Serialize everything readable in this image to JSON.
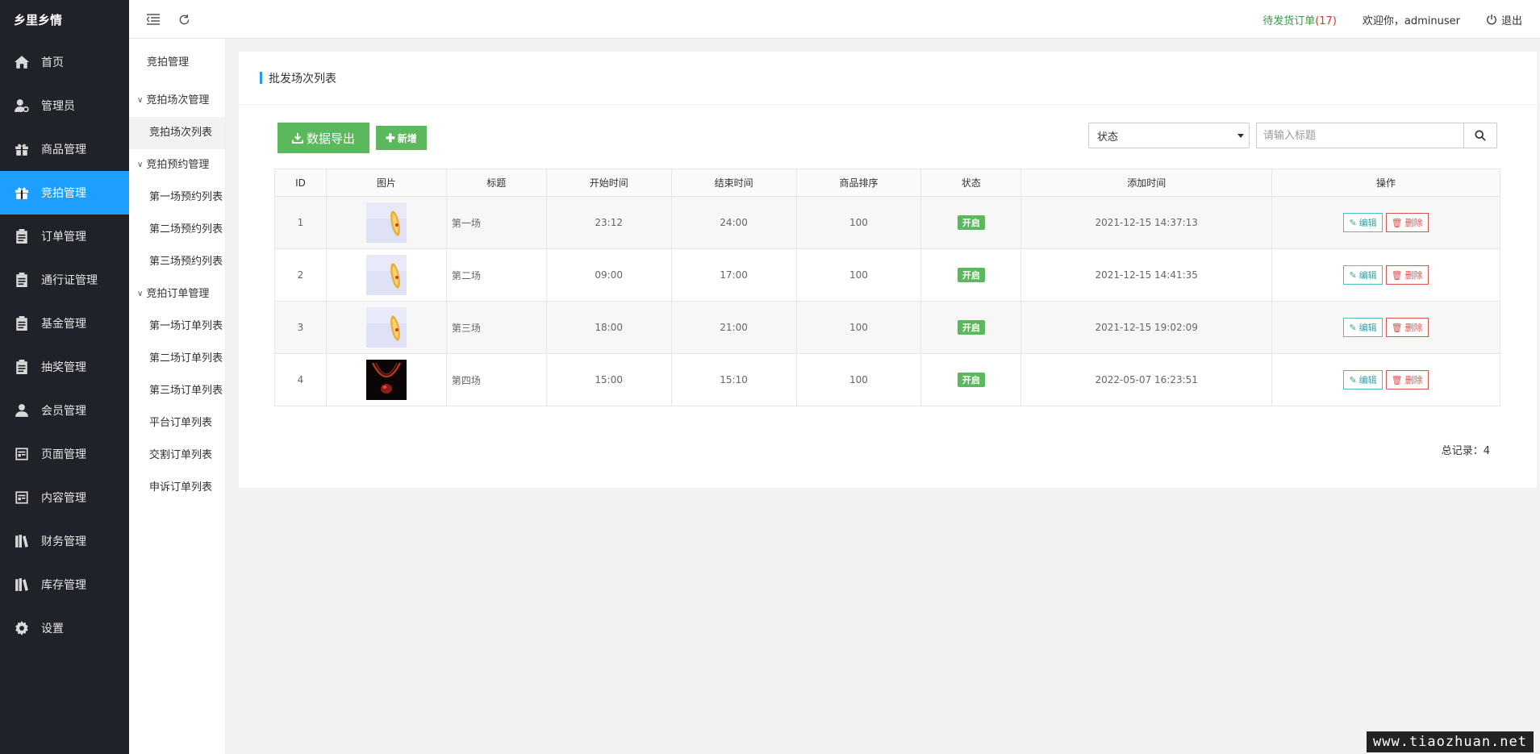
{
  "brand": "乡里乡情",
  "sidebar": {
    "items": [
      {
        "label": "首页",
        "icon": "home-icon"
      },
      {
        "label": "管理员",
        "icon": "admin-icon"
      },
      {
        "label": "商品管理",
        "icon": "gift-icon"
      },
      {
        "label": "竞拍管理",
        "icon": "gift-icon",
        "active": true
      },
      {
        "label": "订单管理",
        "icon": "clipboard-icon"
      },
      {
        "label": "通行证管理",
        "icon": "clipboard-icon"
      },
      {
        "label": "基金管理",
        "icon": "clipboard-icon"
      },
      {
        "label": "抽奖管理",
        "icon": "clipboard-icon"
      },
      {
        "label": "会员管理",
        "icon": "user-icon"
      },
      {
        "label": "页面管理",
        "icon": "page-icon"
      },
      {
        "label": "内容管理",
        "icon": "page-icon"
      },
      {
        "label": "财务管理",
        "icon": "books-icon"
      },
      {
        "label": "库存管理",
        "icon": "books-icon"
      },
      {
        "label": "设置",
        "icon": "gear-icon"
      }
    ]
  },
  "submenu": {
    "title": "竞拍管理",
    "groups": [
      {
        "label": "竞拍场次管理",
        "links": [
          "竞拍场次列表"
        ]
      },
      {
        "label": "竞拍预约管理",
        "links": [
          "第一场预约列表",
          "第二场预约列表",
          "第三场预约列表"
        ]
      },
      {
        "label": "竞拍订单管理",
        "links": [
          "第一场订单列表",
          "第二场订单列表",
          "第三场订单列表",
          "平台订单列表",
          "交割订单列表",
          "申诉订单列表"
        ]
      }
    ]
  },
  "header": {
    "pending_label": "待发货订单",
    "pending_count": "(17)",
    "welcome": "欢迎你，adminuser",
    "logout": "退出"
  },
  "main": {
    "title": "批发场次列表",
    "export_label": "数据导出",
    "add_label": "新增",
    "status_select": "状态",
    "search_placeholder": "请输入标题",
    "table": {
      "headers": [
        "ID",
        "图片",
        "标题",
        "开始时间",
        "结束时间",
        "商品排序",
        "状态",
        "添加时间",
        "操作"
      ],
      "rows": [
        {
          "id": "1",
          "image": "bracelet",
          "title": "第一场",
          "start": "23:12",
          "end": "24:00",
          "sort": "100",
          "status": "开启",
          "added": "2021-12-15 14:37:13"
        },
        {
          "id": "2",
          "image": "bracelet",
          "title": "第二场",
          "start": "09:00",
          "end": "17:00",
          "sort": "100",
          "status": "开启",
          "added": "2021-12-15 14:41:35"
        },
        {
          "id": "3",
          "image": "bracelet",
          "title": "第三场",
          "start": "18:00",
          "end": "21:00",
          "sort": "100",
          "status": "开启",
          "added": "2021-12-15 19:02:09"
        },
        {
          "id": "4",
          "image": "necklace",
          "title": "第四场",
          "start": "15:00",
          "end": "15:10",
          "sort": "100",
          "status": "开启",
          "added": "2022-05-07 16:23:51"
        }
      ],
      "edit_label": "编辑",
      "delete_label": "删除"
    },
    "total": "总记录：4"
  },
  "watermark": "www.tiaozhuan.net",
  "colors": {
    "sidebar_bg": "#20222a",
    "active": "#1e9fff",
    "success": "#5cb85c",
    "danger": "#d9534f",
    "teal": "#4bc0c0"
  }
}
